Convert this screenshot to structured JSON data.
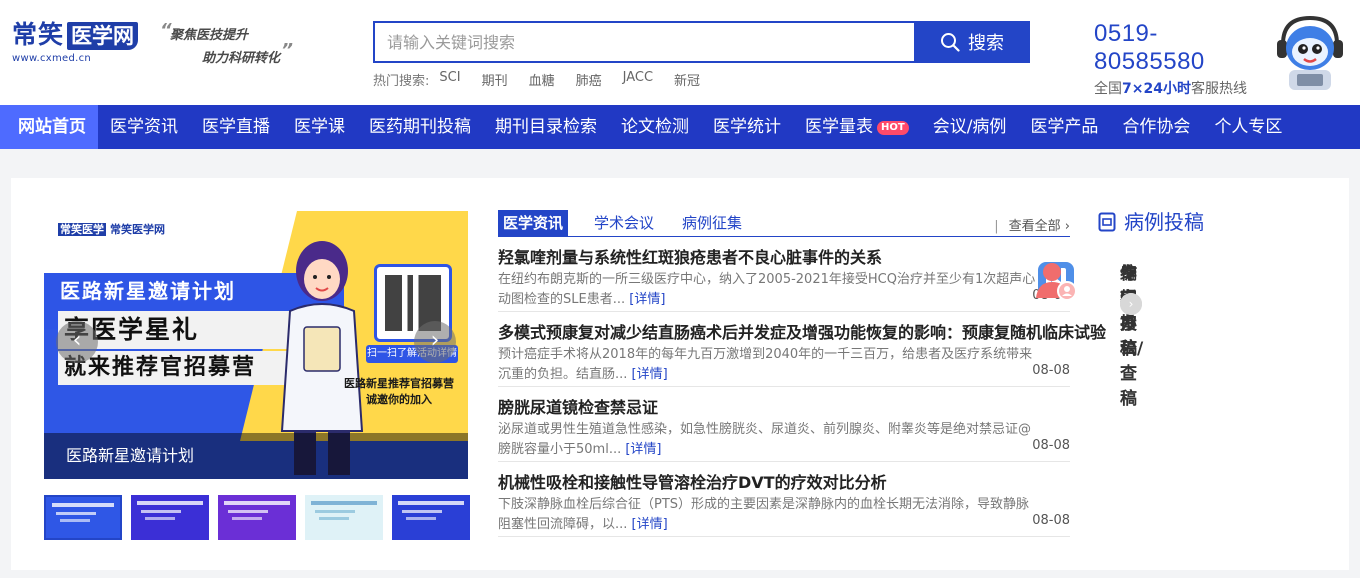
{
  "header": {
    "logo": {
      "name_part1": "常笑",
      "name_part2": "医学网",
      "url": "www.cxmed.cn"
    },
    "slogan": {
      "line1": "聚焦医技提升",
      "line2": "助力科研转化",
      "open_quote": "“",
      "close_quote": "”"
    },
    "search": {
      "placeholder": "请输入关键词搜索",
      "value": "",
      "button_label": "搜索"
    },
    "hot_searches": {
      "label": "热门搜索:",
      "items": [
        "SCI",
        "期刊",
        "血糖",
        "肺癌",
        "JACC",
        "新冠"
      ]
    },
    "hotline": {
      "number": "0519-80585580",
      "desc_prefix": "全国",
      "desc_hours": "7×24小时",
      "desc_suffix": "客服热线"
    }
  },
  "nav": {
    "items": [
      {
        "label": "网站首页",
        "active": true
      },
      {
        "label": "医学资讯"
      },
      {
        "label": "医学直播"
      },
      {
        "label": "医学课"
      },
      {
        "label": "医药期刊投稿"
      },
      {
        "label": "期刊目录检索"
      },
      {
        "label": "论文检测"
      },
      {
        "label": "医学统计"
      },
      {
        "label": "医学量表",
        "badge": "HOT"
      },
      {
        "label": "会议/病例"
      },
      {
        "label": "医学产品"
      },
      {
        "label": "合作协会"
      },
      {
        "label": "个人专区"
      }
    ]
  },
  "carousel": {
    "slide": {
      "logo_a": "常笑医学",
      "logo_b": "常笑医学网",
      "headline": "医路新星邀请计划",
      "line2": "享医学星礼",
      "line3": "就来推荐官招募营",
      "qr_tag": "扫一扫了解活动详情",
      "side_line1": "医路新星推荐官招募营",
      "side_line2": "诚邀你的加入"
    },
    "caption": "医路新星邀请计划",
    "prev_icon": "‹",
    "next_icon": "›",
    "thumb_colors": [
      "#2f57e6",
      "#3b2fd6",
      "#6b2fd6",
      "#dff2f7",
      "#2a3fd6"
    ]
  },
  "news": {
    "tabs": [
      "医学资讯",
      "学术会议",
      "病例征集"
    ],
    "view_all": "查看全部",
    "view_all_sep": "|",
    "view_all_arrow": "›",
    "more_label": "[详情]",
    "items": [
      {
        "title": "羟氯喹剂量与系统性红斑狼疮患者不良心脏事件的关系",
        "desc": "在纽约布朗克斯的一所三级医疗中心，纳入了2005-2021年接受HCQ治疗并至少有1次超声心动图检查的SLE患者...",
        "date": "08-08"
      },
      {
        "title": "多模式预康复对减少结直肠癌术后并发症及增强功能恢复的影响：预康复随机临床试验",
        "desc": "预计癌症手术将从2018年的每年九百万激增到2040年的一千三百万，给患者及医疗系统带来沉重的负担。结直肠...",
        "date": "08-08"
      },
      {
        "title": "膀胱尿道镜检查禁忌证",
        "desc": "泌尿道或男性生殖道急性感染，如急性膀胱炎、尿道炎、前列腺炎、附睾炎等是绝对禁忌证@膀胱容量小于50ml...",
        "date": "08-08"
      },
      {
        "title": "机械性吸栓和接触性导管溶栓治疗DVT的疗效对比分析",
        "desc": "下肢深静脉血栓后综合征（PTS）形成的主要因素是深静脉内的血栓长期无法消除，导致静脉阻塞性回流障碍，以...",
        "date": "08-08"
      }
    ]
  },
  "side": {
    "title": "病例投稿",
    "cards": [
      {
        "label": "作者投稿/查稿",
        "bg": "#fdf3e3",
        "icon": "mail-icon",
        "color": "#f6a33c"
      },
      {
        "label": "编辑办公",
        "bg": "#e8f0fb",
        "icon": "bookmark-icon",
        "color": "#4f8fe8"
      },
      {
        "label": "专家审稿",
        "bg": "#fdeeee",
        "icon": "expert-user-icon",
        "color": "#f06d6d"
      }
    ],
    "go_icon": "›"
  }
}
